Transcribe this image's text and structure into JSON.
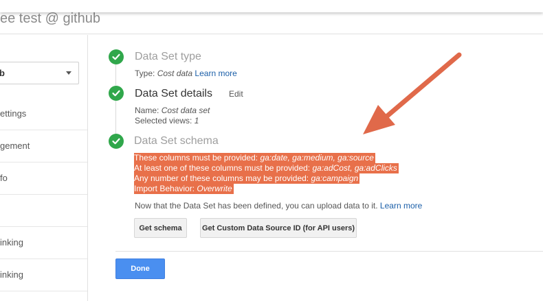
{
  "header": {
    "title": "ee test @ github"
  },
  "sidebar": {
    "selector_value": "b",
    "items": [
      {
        "label": "ettings"
      },
      {
        "label": "gement"
      },
      {
        "label": "fo"
      },
      {
        "label": ""
      },
      {
        "label": "inking"
      },
      {
        "label": "inking"
      }
    ]
  },
  "steps": {
    "type": {
      "title": "Data Set type",
      "type_label": "Type:",
      "type_value": "Cost data",
      "learn_more": "Learn more"
    },
    "details": {
      "title": "Data Set details",
      "edit": "Edit",
      "name_label": "Name:",
      "name_value": "Cost data set",
      "views_label": "Selected views:",
      "views_value": "1"
    },
    "schema": {
      "title": "Data Set schema",
      "required_label": "These columns must be provided:",
      "required_value": "ga:date, ga:medium, ga:source",
      "atleast_label": "At least one of these columns must be provided:",
      "atleast_value": "ga:adCost, ga:adClicks",
      "any_label": "Any number of these columns may be provided:",
      "any_value": "ga:campaign",
      "behavior_label": "Import Behavior:",
      "behavior_value": "Overwrite",
      "info_text": "Now that the Data Set has been defined, you can upload data to it.",
      "info_link": "Learn more",
      "get_schema_button": "Get schema",
      "get_id_button": "Get Custom Data Source ID (for API users)"
    }
  },
  "done_button": "Done",
  "colors": {
    "check_green": "#30a74b",
    "highlight": "#e8704a",
    "arrow": "#e0694a",
    "primary_button": "#4a8ff0",
    "link": "#1a5ea8"
  }
}
